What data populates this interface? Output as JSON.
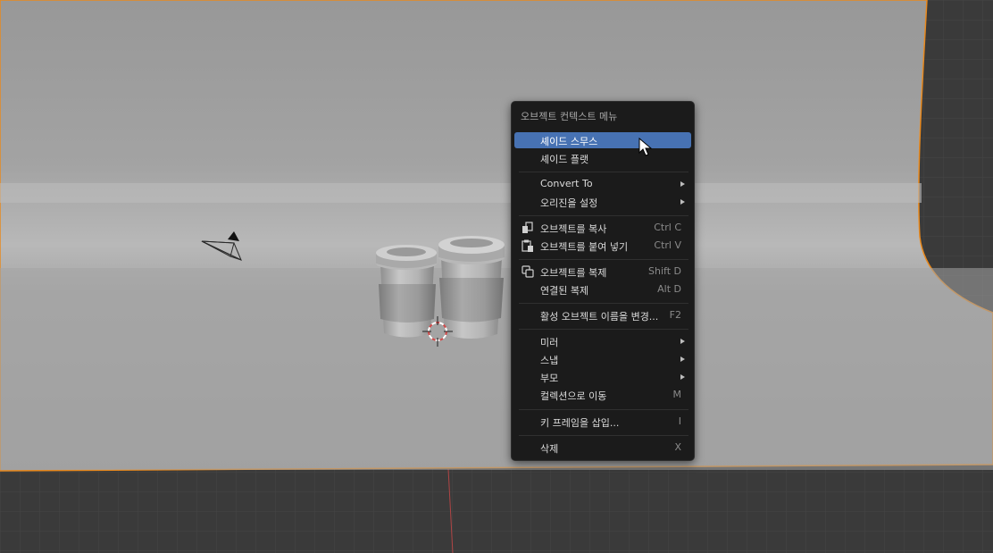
{
  "context_menu": {
    "title": "오브젝트 컨텍스트 메뉴",
    "items": [
      {
        "label": "셰이드 스무스",
        "shortcut": "",
        "submenu": false,
        "highlighted": true
      },
      {
        "label": "셰이드 플랫",
        "shortcut": "",
        "submenu": false
      },
      {
        "label": "Convert To",
        "shortcut": "",
        "submenu": true
      },
      {
        "label": "오리진을 설정",
        "shortcut": "",
        "submenu": true
      },
      {
        "label": "오브젝트를 복사",
        "shortcut": "Ctrl C",
        "submenu": false,
        "icon": "copy-icon"
      },
      {
        "label": "오브젝트를 붙여 넣기",
        "shortcut": "Ctrl V",
        "submenu": false,
        "icon": "paste-icon"
      },
      {
        "label": "오브젝트를 복제",
        "shortcut": "Shift D",
        "submenu": false,
        "icon": "duplicate-icon"
      },
      {
        "label": "연결된 복제",
        "shortcut": "Alt D",
        "submenu": false
      },
      {
        "label": "활성 오브젝트 이름을 변경...",
        "shortcut": "F2",
        "submenu": false
      },
      {
        "label": "미러",
        "shortcut": "",
        "submenu": true
      },
      {
        "label": "스냅",
        "shortcut": "",
        "submenu": true
      },
      {
        "label": "부모",
        "shortcut": "",
        "submenu": true
      },
      {
        "label": "컬렉션으로 이동",
        "shortcut": "M",
        "submenu": false
      },
      {
        "label": "키 프레임을 삽입...",
        "shortcut": "I",
        "submenu": false
      },
      {
        "label": "삭제",
        "shortcut": "X",
        "submenu": false
      }
    ]
  },
  "colors": {
    "highlight": "#4772b3",
    "selection_outline": "#e8891e",
    "backdrop": "#a9a9a9",
    "grid_floor": "#3a3a3a",
    "menu_bg": "#1b1b1b"
  }
}
